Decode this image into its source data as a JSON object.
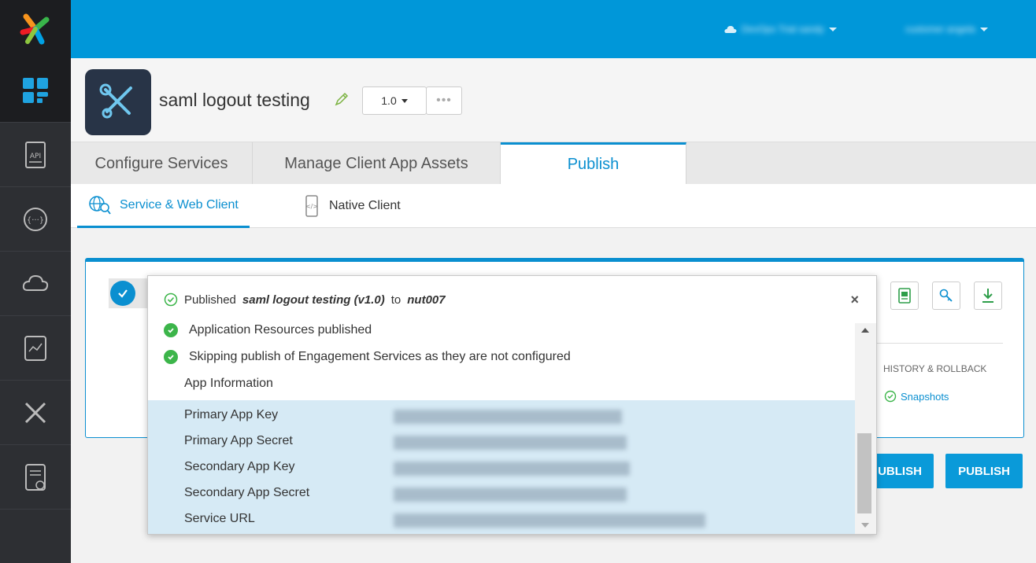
{
  "topbar": {
    "account_label": "DevOps Trial sandy",
    "user_label": "customer angela"
  },
  "app": {
    "title": "saml logout testing",
    "version": "1.0",
    "more": "•••"
  },
  "tabs": [
    {
      "label": "Configure Services"
    },
    {
      "label": "Manage Client App Assets"
    },
    {
      "label": "Publish"
    }
  ],
  "subtabs": [
    {
      "label": "Service & Web Client"
    },
    {
      "label": "Native Client"
    }
  ],
  "panel": {
    "history_label": "HISTORY & ROLLBACK",
    "snapshots_label": "Snapshots",
    "unpublish_label": "UBLISH",
    "publish_label": "PUBLISH"
  },
  "popup": {
    "prefix": "Published",
    "app_version": "saml logout testing (v1.0)",
    "to": "to",
    "target": "nut007",
    "close": "×",
    "status_1": "Application Resources published",
    "status_2": "Skipping publish of Engagement Services as they are not configured",
    "app_info": "App Information",
    "keys": [
      {
        "label": "Primary App Key"
      },
      {
        "label": "Primary App Secret"
      },
      {
        "label": "Secondary App Key"
      },
      {
        "label": "Secondary App Secret"
      },
      {
        "label": "Service URL"
      }
    ]
  },
  "colors": {
    "brand_blue": "#0097d9",
    "accent": "#0a8fd0",
    "success": "#3cb54a",
    "rail": "#2d2f33"
  },
  "icons": [
    "app-logo-icon",
    "dashboard-icon",
    "api-icon",
    "chat-icon",
    "cloud-icon",
    "analytics-icon",
    "tools-icon",
    "document-icon"
  ]
}
